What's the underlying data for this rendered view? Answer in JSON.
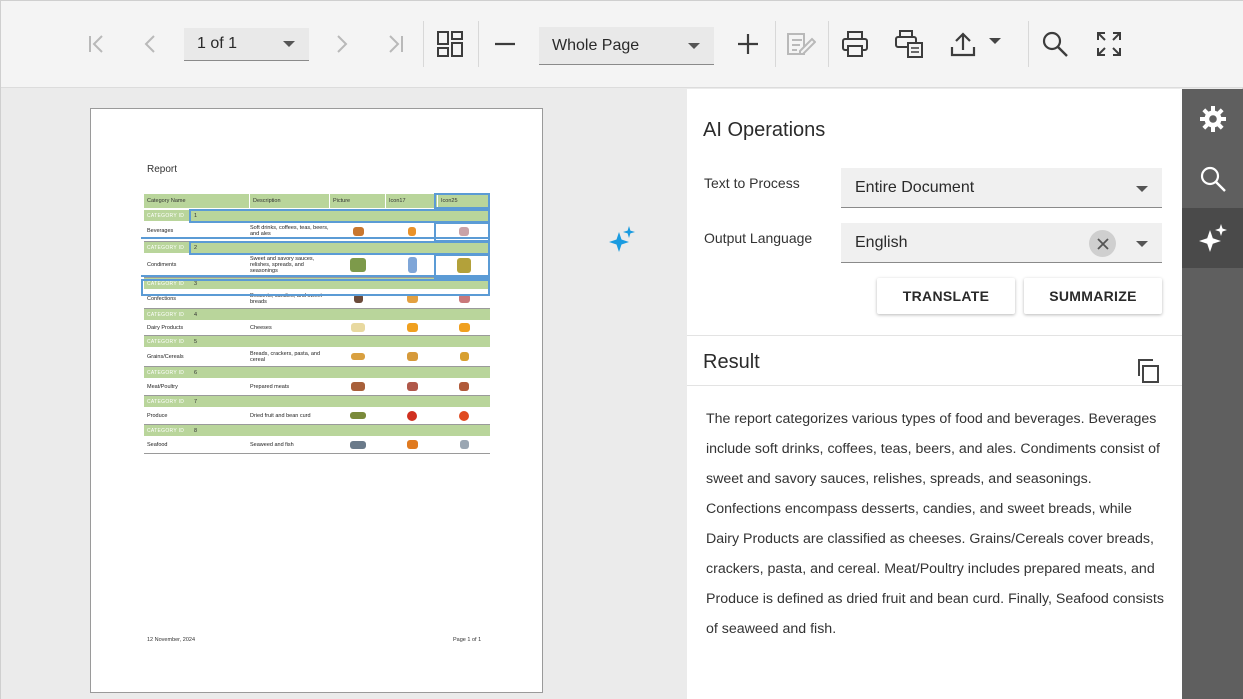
{
  "toolbar": {
    "page_selector": "1 of 1",
    "zoom_selector": "Whole Page"
  },
  "report": {
    "title": "Report",
    "columns": [
      "Category Name",
      "Description",
      "Picture",
      "Icon17",
      "Icon25"
    ],
    "category_label": "CATEGORY ID",
    "rows": [
      {
        "id": "1",
        "name": "Beverages",
        "description": "Soft drinks, coffees, teas, beers, and ales"
      },
      {
        "id": "2",
        "name": "Condiments",
        "description": "Sweet and savory sauces, relishes, spreads, and seasonings"
      },
      {
        "id": "3",
        "name": "Confections",
        "description": "Desserts, candies, and sweet breads"
      },
      {
        "id": "4",
        "name": "Dairy Products",
        "description": "Cheeses"
      },
      {
        "id": "5",
        "name": "Grains/Cereals",
        "description": "Breads, crackers, pasta, and cereal"
      },
      {
        "id": "6",
        "name": "Meat/Poultry",
        "description": "Prepared meats"
      },
      {
        "id": "7",
        "name": "Produce",
        "description": "Dried fruit and bean curd"
      },
      {
        "id": "8",
        "name": "Seafood",
        "description": "Seaweed and fish"
      }
    ],
    "footer_date": "12 November, 2024",
    "footer_page": "Page 1 of 1"
  },
  "ai_panel": {
    "title": "AI Operations",
    "text_to_process_label": "Text to Process",
    "text_to_process_value": "Entire Document",
    "output_language_label": "Output Language",
    "output_language_value": "English",
    "translate_label": "TRANSLATE",
    "summarize_label": "SUMMARIZE",
    "result_title": "Result",
    "result_text": "The report categorizes various types of food and beverages. Beverages include soft drinks, coffees, teas, beers, and ales. Condiments consist of sweet and savory sauces, relishes, spreads, and seasonings. Confections encompass desserts, candies, and sweet breads, while Dairy Products are classified as cheeses. Grains/Cereals cover breads, crackers, pasta, and cereal. Meat/Poultry includes prepared meats, and Produce is defined as dried fruit and bean curd. Finally, Seafood consists of seaweed and fish."
  },
  "sidebar": {
    "items": [
      "gear-icon",
      "search-icon",
      "sparkle-icon"
    ],
    "active": "sparkle-icon"
  },
  "colors": {
    "accent": "#1a9be0",
    "table_header": "#b9d59b",
    "selection": "#5b9bd5",
    "sidebar": "#5f5f5f"
  }
}
